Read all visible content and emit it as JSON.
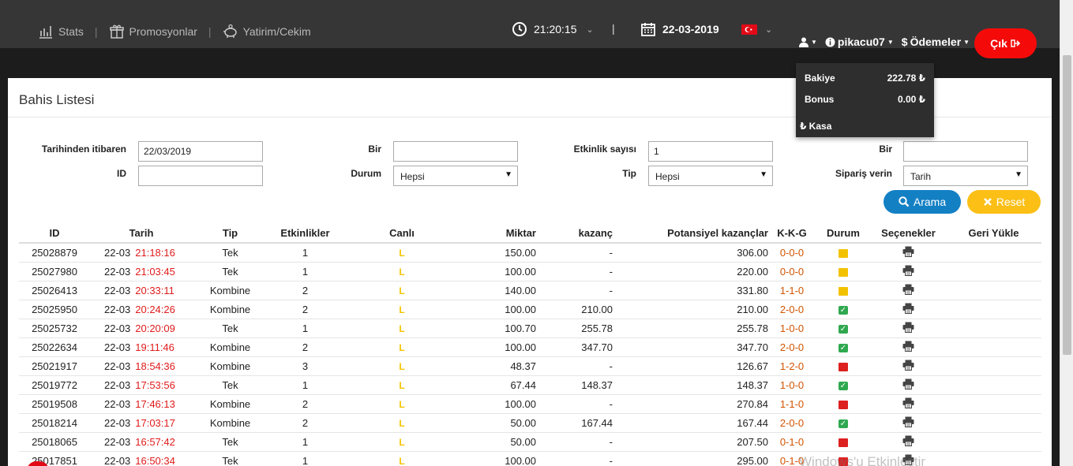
{
  "topnav": {
    "stats": "Stats",
    "promos": "Promosyonlar",
    "invest": "Yatirim/Cekim",
    "sep": "|"
  },
  "clock": {
    "time": "21:20:15"
  },
  "divider": "|",
  "date": {
    "value": "22-03-2019"
  },
  "user": {
    "name": "pikacu07",
    "payments": "Ödemeler",
    "logout": "Çık"
  },
  "balance": {
    "bakiye_label": "Bakiye",
    "bakiye_value": "222.78 ₺",
    "bonus_label": "Bonus",
    "bonus_value": "0.00 ₺",
    "kasa": "₺ Kasa"
  },
  "page": {
    "title": "Bahis Listesi"
  },
  "filters": {
    "from_label": "Tarihinden itibaren",
    "from_value": "22/03/2019",
    "id_label": "ID",
    "id_value": "",
    "bir1_label": "Bir",
    "bir1_value": "",
    "durum_label": "Durum",
    "durum_value": "Hepsi",
    "etkinlik_label": "Etkinlik sayısı",
    "etkinlik_value": "1",
    "tip_label": "Tip",
    "tip_value": "Hepsi",
    "bir2_label": "Bir",
    "bir2_value": "",
    "order_label": "Sipariş verin",
    "order_value": "Tarih",
    "search": "Arama",
    "reset": "Reset"
  },
  "table": {
    "headers": {
      "id": "ID",
      "tarih": "Tarih",
      "tip": "Tip",
      "etkinlikler": "Etkinlikler",
      "canli": "Canlı",
      "miktar": "Miktar",
      "kazanc": "kazanç",
      "potansiyel": "Potansiyel kazançlar",
      "kkg": "K-K-G",
      "durum": "Durum",
      "secenekler": "Seçenekler",
      "geri": "Geri Yükle"
    },
    "rows": [
      {
        "id": "25028879",
        "day": "22-03",
        "time": "21:18:16",
        "tip": "Tek",
        "etk": "1",
        "canli": "L",
        "miktar": "150.00",
        "kazanc": "-",
        "pot": "306.00",
        "kkg": "0-0-0",
        "status": "pending"
      },
      {
        "id": "25027980",
        "day": "22-03",
        "time": "21:03:45",
        "tip": "Tek",
        "etk": "1",
        "canli": "L",
        "miktar": "100.00",
        "kazanc": "-",
        "pot": "220.00",
        "kkg": "0-0-0",
        "status": "pending"
      },
      {
        "id": "25026413",
        "day": "22-03",
        "time": "20:33:11",
        "tip": "Kombine",
        "etk": "2",
        "canli": "L",
        "miktar": "140.00",
        "kazanc": "-",
        "pot": "331.80",
        "kkg": "1-1-0",
        "status": "pending"
      },
      {
        "id": "25025950",
        "day": "22-03",
        "time": "20:24:26",
        "tip": "Kombine",
        "etk": "2",
        "canli": "L",
        "miktar": "100.00",
        "kazanc": "210.00",
        "pot": "210.00",
        "kkg": "2-0-0",
        "status": "won"
      },
      {
        "id": "25025732",
        "day": "22-03",
        "time": "20:20:09",
        "tip": "Tek",
        "etk": "1",
        "canli": "L",
        "miktar": "100.70",
        "kazanc": "255.78",
        "pot": "255.78",
        "kkg": "1-0-0",
        "status": "won"
      },
      {
        "id": "25022634",
        "day": "22-03",
        "time": "19:11:46",
        "tip": "Kombine",
        "etk": "2",
        "canli": "L",
        "miktar": "100.00",
        "kazanc": "347.70",
        "pot": "347.70",
        "kkg": "2-0-0",
        "status": "won"
      },
      {
        "id": "25021917",
        "day": "22-03",
        "time": "18:54:36",
        "tip": "Kombine",
        "etk": "3",
        "canli": "L",
        "miktar": "48.37",
        "kazanc": "-",
        "pot": "126.67",
        "kkg": "1-2-0",
        "status": "lost"
      },
      {
        "id": "25019772",
        "day": "22-03",
        "time": "17:53:56",
        "tip": "Tek",
        "etk": "1",
        "canli": "L",
        "miktar": "67.44",
        "kazanc": "148.37",
        "pot": "148.37",
        "kkg": "1-0-0",
        "status": "won"
      },
      {
        "id": "25019508",
        "day": "22-03",
        "time": "17:46:13",
        "tip": "Kombine",
        "etk": "2",
        "canli": "L",
        "miktar": "100.00",
        "kazanc": "-",
        "pot": "270.84",
        "kkg": "1-1-0",
        "status": "lost"
      },
      {
        "id": "25018214",
        "day": "22-03",
        "time": "17:03:17",
        "tip": "Kombine",
        "etk": "2",
        "canli": "L",
        "miktar": "50.00",
        "kazanc": "167.44",
        "pot": "167.44",
        "kkg": "2-0-0",
        "status": "won"
      },
      {
        "id": "25018065",
        "day": "22-03",
        "time": "16:57:42",
        "tip": "Tek",
        "etk": "1",
        "canli": "L",
        "miktar": "50.00",
        "kazanc": "-",
        "pot": "207.50",
        "kkg": "0-1-0",
        "status": "lost"
      },
      {
        "id": "25017851",
        "day": "22-03",
        "time": "16:50:34",
        "tip": "Tek",
        "etk": "1",
        "canli": "L",
        "miktar": "100.00",
        "kazanc": "-",
        "pot": "295.00",
        "kkg": "0-1-0",
        "status": "lost"
      }
    ]
  },
  "watermark": "Windows'u Etkinleştir"
}
